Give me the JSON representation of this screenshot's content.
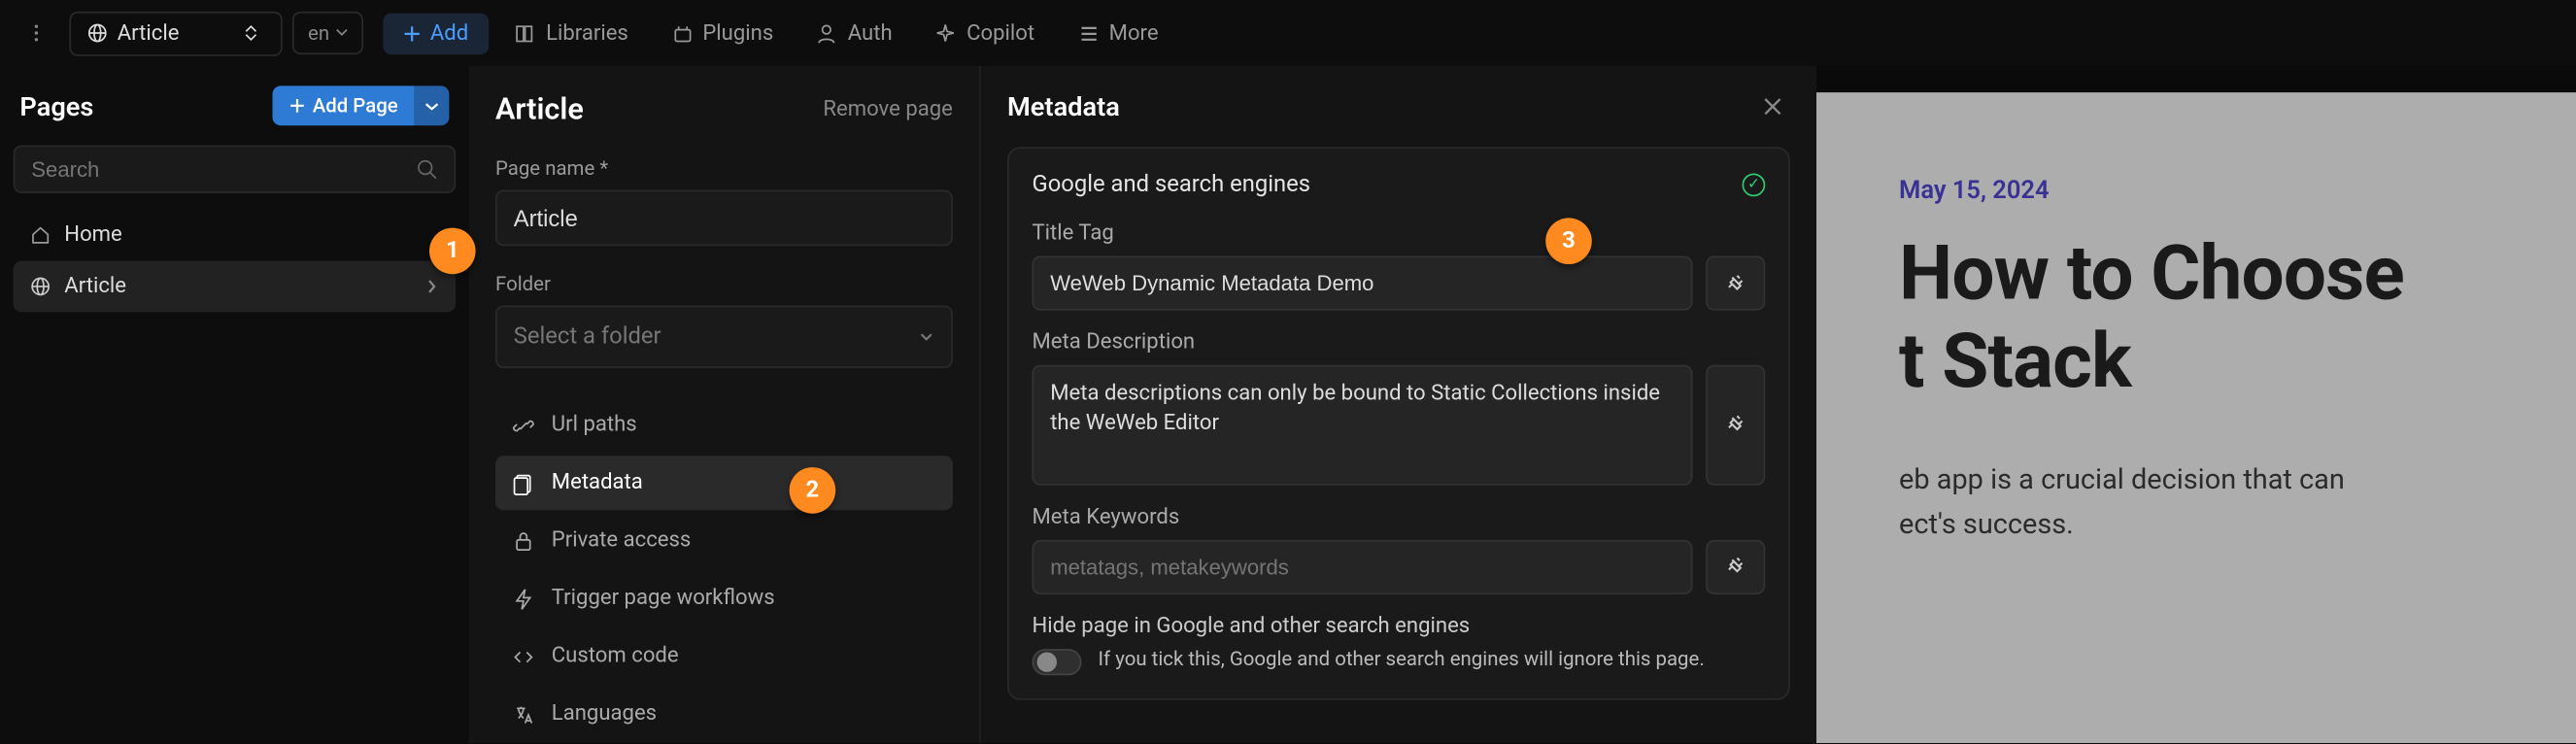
{
  "topbar": {
    "page_selector": "Article",
    "locale": "en",
    "add": "Add",
    "libraries": "Libraries",
    "plugins": "Plugins",
    "auth": "Auth",
    "copilot": "Copilot",
    "more": "More"
  },
  "sidebar": {
    "title": "Pages",
    "add_page": "Add Page",
    "search_placeholder": "Search",
    "items": [
      {
        "label": "Home",
        "icon": "home"
      },
      {
        "label": "Article",
        "icon": "globe",
        "active": true
      }
    ]
  },
  "center": {
    "title": "Article",
    "remove": "Remove page",
    "page_name_label": "Page name",
    "page_name_value": "Article",
    "folder_label": "Folder",
    "folder_placeholder": "Select a folder",
    "settings": [
      {
        "icon": "link",
        "label": "Url paths"
      },
      {
        "icon": "doc",
        "label": "Metadata",
        "active": true
      },
      {
        "icon": "lock",
        "label": "Private access"
      },
      {
        "icon": "bolt",
        "label": "Trigger page workflows"
      },
      {
        "icon": "code",
        "label": "Custom code"
      },
      {
        "icon": "lang",
        "label": "Languages"
      }
    ]
  },
  "metadata": {
    "title": "Metadata",
    "card_title": "Google and search engines",
    "title_tag_label": "Title Tag",
    "title_tag_value": "WeWeb Dynamic Metadata Demo",
    "desc_label": "Meta Description",
    "desc_value": "Meta descriptions can only be bound to Static Collections inside the WeWeb Editor",
    "keywords_label": "Meta Keywords",
    "keywords_placeholder": "metatags, metakeywords",
    "hide_label": "Hide page in Google and other search engines",
    "hide_desc": "If you tick this, Google and other search engines will ignore this page."
  },
  "preview": {
    "date": "May 15, 2024",
    "title_line1": "How to Choose",
    "title_line2": "t Stack",
    "body_line1": "eb app is a crucial decision that can",
    "body_line2": "ect's success."
  },
  "callouts": {
    "c1": "1",
    "c2": "2",
    "c3": "3"
  }
}
